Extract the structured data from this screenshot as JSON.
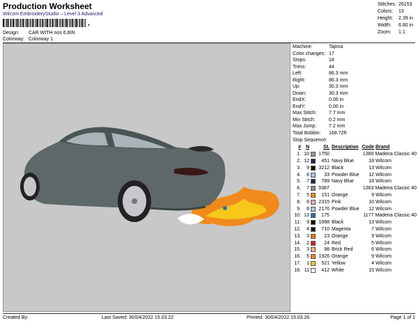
{
  "header": {
    "title": "Production Worksheet",
    "subtitle": "Wilcom EmbroideryStudio – Level 3 Advanced",
    "barcode_suffix": ",",
    "design_label": "Design:",
    "design_value": "CAR WITH nos 6,8IN",
    "colorway_label": "Colorway:",
    "colorway_value": "Colorway 1"
  },
  "stats": [
    {
      "k": "Stitches:",
      "v": "26153"
    },
    {
      "k": "Colors:",
      "v": "13"
    },
    {
      "k": "Height:",
      "v": "2.39 in"
    },
    {
      "k": "Width:",
      "v": "6.80 in"
    },
    {
      "k": "Zoom:",
      "v": "1:1"
    }
  ],
  "machine_info": [
    {
      "k": "Machine:",
      "v": "Tajima"
    },
    {
      "k": "Color changes:",
      "v": "17"
    },
    {
      "k": "Stops:",
      "v": "18"
    },
    {
      "k": "Trims:",
      "v": "44"
    },
    {
      "k": "Left:",
      "v": "86.3 mm"
    },
    {
      "k": "Right:",
      "v": "86.3 mm"
    },
    {
      "k": "Up:",
      "v": "30.3 mm"
    },
    {
      "k": "Down:",
      "v": "30.3 mm"
    },
    {
      "k": "EndX:",
      "v": "0.00 in"
    },
    {
      "k": "EndY:",
      "v": "0.00 in"
    },
    {
      "k": "Max Stitch:",
      "v": "7.7 mm"
    },
    {
      "k": "Min Stitch:",
      "v": "0.2 mm"
    },
    {
      "k": "Max Jump:",
      "v": "7.2 mm"
    },
    {
      "k": "Total Bobbin:",
      "v": "168.72ft"
    }
  ],
  "stop_sequence": {
    "title": "Stop Sequence:",
    "headers": {
      "num": "#",
      "n": "N",
      "st": "St.",
      "desc": "Description",
      "code": "Code",
      "brand": "Brand"
    },
    "rows": [
      {
        "num": "1.",
        "n": "10",
        "color": "#8a9aa0",
        "st": "1750",
        "desc": "",
        "code": "1360",
        "brand": "Madeira Classic 40"
      },
      {
        "num": "2.",
        "n": "12",
        "color": "#1b2a4a",
        "st": "451",
        "desc": "Navy Blue",
        "code": "18",
        "brand": "Wilcom"
      },
      {
        "num": "3.",
        "n": "9",
        "color": "#111111",
        "st": "3212",
        "desc": "Black",
        "code": "13",
        "brand": "Wilcom"
      },
      {
        "num": "4.",
        "n": "8",
        "color": "#a8c4e0",
        "st": "33",
        "desc": "Powder Blue",
        "code": "12",
        "brand": "Wilcom"
      },
      {
        "num": "5.",
        "n": "7",
        "color": "#1b2a4a",
        "st": "789",
        "desc": "Navy Blue",
        "code": "18",
        "brand": "Wilcom"
      },
      {
        "num": "6.",
        "n": "7",
        "color": "#7d8a8c",
        "st": "9387",
        "desc": "",
        "code": "1363",
        "brand": "Madeira Classic 40"
      },
      {
        "num": "7.",
        "n": "5",
        "color": "#f08a1c",
        "st": "151",
        "desc": "Orange",
        "code": "9",
        "brand": "Wilcom"
      },
      {
        "num": "8.",
        "n": "6",
        "color": "#f4a6b8",
        "st": "2315",
        "desc": "Pink",
        "code": "10",
        "brand": "Wilcom"
      },
      {
        "num": "9.",
        "n": "8",
        "color": "#a8c4e0",
        "st": "2176",
        "desc": "Powder Blue",
        "code": "12",
        "brand": "Wilcom"
      },
      {
        "num": "10.",
        "n": "13",
        "color": "#2f6fb5",
        "st": "175",
        "desc": "",
        "code": "1177",
        "brand": "Madeira Classic 40"
      },
      {
        "num": "11.",
        "n": "9",
        "color": "#111111",
        "st": "1998",
        "desc": "Black",
        "code": "13",
        "brand": "Wilcom"
      },
      {
        "num": "12.",
        "n": "4",
        "color": "#1a1a1a",
        "st": "710",
        "desc": "Magenta",
        "code": "7",
        "brand": "Wilcom"
      },
      {
        "num": "13.",
        "n": "3",
        "color": "#e8721c",
        "st": "23",
        "desc": "Orange",
        "code": "9",
        "brand": "Wilcom"
      },
      {
        "num": "14.",
        "n": "2",
        "color": "#d42020",
        "st": "24",
        "desc": "Red",
        "code": "5",
        "brand": "Wilcom"
      },
      {
        "num": "15.",
        "n": "3",
        "color": "#e8b08a",
        "st": "98",
        "desc": "Brick Red",
        "code": "6",
        "brand": "Wilcom"
      },
      {
        "num": "16.",
        "n": "5",
        "color": "#f08a1c",
        "st": "1926",
        "desc": "Orange",
        "code": "9",
        "brand": "Wilcom"
      },
      {
        "num": "17.",
        "n": "1",
        "color": "#f5c81a",
        "st": "521",
        "desc": "Yellow",
        "code": "4",
        "brand": "Wilcom"
      },
      {
        "num": "18.",
        "n": "11",
        "color": "#ffffff",
        "st": "412",
        "desc": "White",
        "code": "15",
        "brand": "Wilcom"
      }
    ]
  },
  "footer": {
    "created_by": "Created By:",
    "last_saved": "Last Saved: 30/04/2022 15.03.22",
    "printed": "Printed: 30/04/2022 15.03.26",
    "page": "Page 1 of 1"
  },
  "colors": {
    "canvas_bg": "#c8c8c8",
    "car_body": "#5f6868",
    "flame_orange": "#f08a1c",
    "flame_yellow": "#f5c81a"
  }
}
